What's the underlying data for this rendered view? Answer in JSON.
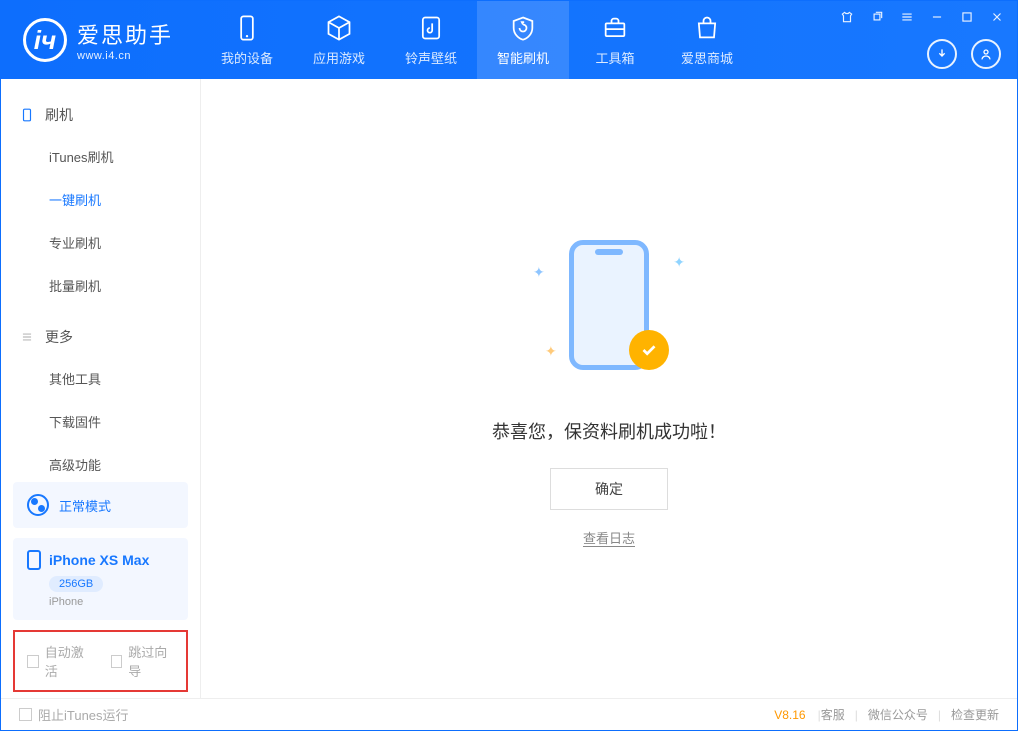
{
  "app": {
    "name": "爱思助手",
    "url": "www.i4.cn"
  },
  "tabs": {
    "device": "我的设备",
    "apps": "应用游戏",
    "ringtone": "铃声壁纸",
    "flash": "智能刷机",
    "toolbox": "工具箱",
    "store": "爱思商城"
  },
  "sidebar": {
    "group_flash": "刷机",
    "items_flash": [
      {
        "label": "iTunes刷机"
      },
      {
        "label": "一键刷机"
      },
      {
        "label": "专业刷机"
      },
      {
        "label": "批量刷机"
      }
    ],
    "group_more": "更多",
    "items_more": [
      {
        "label": "其他工具"
      },
      {
        "label": "下载固件"
      },
      {
        "label": "高级功能"
      }
    ],
    "mode": "正常模式",
    "device": {
      "name": "iPhone XS Max",
      "capacity": "256GB",
      "type": "iPhone"
    },
    "checkbox_auto_activate": "自动激活",
    "checkbox_skip_guide": "跳过向导"
  },
  "main": {
    "success_message": "恭喜您，保资料刷机成功啦！",
    "ok_button": "确定",
    "view_log": "查看日志"
  },
  "footer": {
    "block_itunes": "阻止iTunes运行",
    "version": "V8.16",
    "link_service": "客服",
    "link_wechat": "微信公众号",
    "link_update": "检查更新"
  }
}
